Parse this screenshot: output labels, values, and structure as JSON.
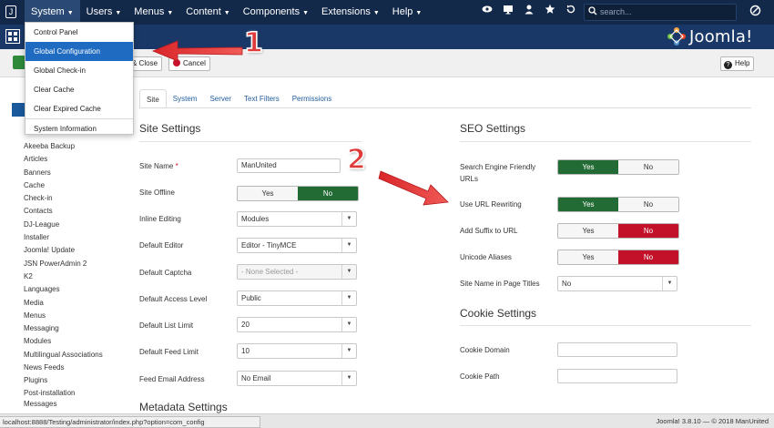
{
  "topnav": {
    "menu": [
      {
        "label": "System",
        "open": true
      },
      {
        "label": "Users"
      },
      {
        "label": "Menus"
      },
      {
        "label": "Content"
      },
      {
        "label": "Components"
      },
      {
        "label": "Extensions"
      },
      {
        "label": "Help"
      }
    ],
    "search_placeholder": "search...",
    "icons": [
      "eye-icon",
      "monitor-icon",
      "user-icon",
      "star-icon",
      "refresh-icon"
    ]
  },
  "header": {
    "brand": "Joomla!"
  },
  "system_menu": {
    "items": [
      {
        "label": "Control Panel"
      },
      {
        "label": "Global Configuration",
        "active": true
      },
      {
        "label": "Global Check-in"
      },
      {
        "label": "Clear Cache"
      },
      {
        "label": "Clear Expired Cache"
      },
      {
        "label": "System Information"
      }
    ]
  },
  "toolbar": {
    "save_close": "& Close",
    "cancel": "Cancel",
    "help": "Help"
  },
  "callouts": {
    "one": "1",
    "two": "2"
  },
  "sidebar": {
    "items": [
      "Akeeba Backup",
      "Articles",
      "Banners",
      "Cache",
      "Check-in",
      "Contacts",
      "DJ-League",
      "Installer",
      "Joomla! Update",
      "JSN PowerAdmin 2",
      "K2",
      "Languages",
      "Media",
      "Menus",
      "Messaging",
      "Modules",
      "Multilingual Associations",
      "News Feeds",
      "Plugins",
      "Post-installation Messages"
    ]
  },
  "tabs": [
    "Site",
    "System",
    "Server",
    "Text Filters",
    "Permissions"
  ],
  "site_settings": {
    "title": "Site Settings",
    "site_name": {
      "label": "Site Name",
      "required": "*",
      "value": "ManUnited"
    },
    "site_offline": {
      "label": "Site Offline",
      "yes": "Yes",
      "no": "No",
      "value": "No"
    },
    "inline_editing": {
      "label": "Inline Editing",
      "value": "Modules"
    },
    "default_editor": {
      "label": "Default Editor",
      "value": "Editor - TinyMCE"
    },
    "default_captcha": {
      "label": "Default Captcha",
      "value": "- None Selected -"
    },
    "default_access": {
      "label": "Default Access Level",
      "value": "Public"
    },
    "default_list_limit": {
      "label": "Default List Limit",
      "value": "20"
    },
    "default_feed_limit": {
      "label": "Default Feed Limit",
      "value": "10"
    },
    "feed_email": {
      "label": "Feed Email Address",
      "value": "No Email"
    }
  },
  "metadata_title": "Metadata Settings",
  "seo_settings": {
    "title": "SEO Settings",
    "sef_urls": {
      "label": "Search Engine Friendly URLs",
      "yes": "Yes",
      "no": "No",
      "value": "Yes"
    },
    "url_rewriting": {
      "label": "Use URL Rewriting",
      "yes": "Yes",
      "no": "No",
      "value": "Yes"
    },
    "suffix": {
      "label": "Add Suffix to URL",
      "yes": "Yes",
      "no": "No",
      "value": "No"
    },
    "unicode": {
      "label": "Unicode Aliases",
      "yes": "Yes",
      "no": "No",
      "value": "No"
    },
    "sitename_titles": {
      "label": "Site Name in Page Titles",
      "value": "No"
    }
  },
  "cookie_settings": {
    "title": "Cookie Settings",
    "domain": {
      "label": "Cookie Domain",
      "value": ""
    },
    "path": {
      "label": "Cookie Path",
      "value": ""
    }
  },
  "statusbar": {
    "url": "localhost:8888/Testing/administrator/index.php?option=com_config",
    "right": "Joomla! 3.8.10 — © 2018 ManUnited"
  },
  "colors": {
    "nav": "#13294a",
    "header": "#1a3867",
    "toggle_green": "#236b34",
    "toggle_red": "#c3112a",
    "active_menu": "#1f6bc1",
    "callout": "#e03b3b"
  }
}
